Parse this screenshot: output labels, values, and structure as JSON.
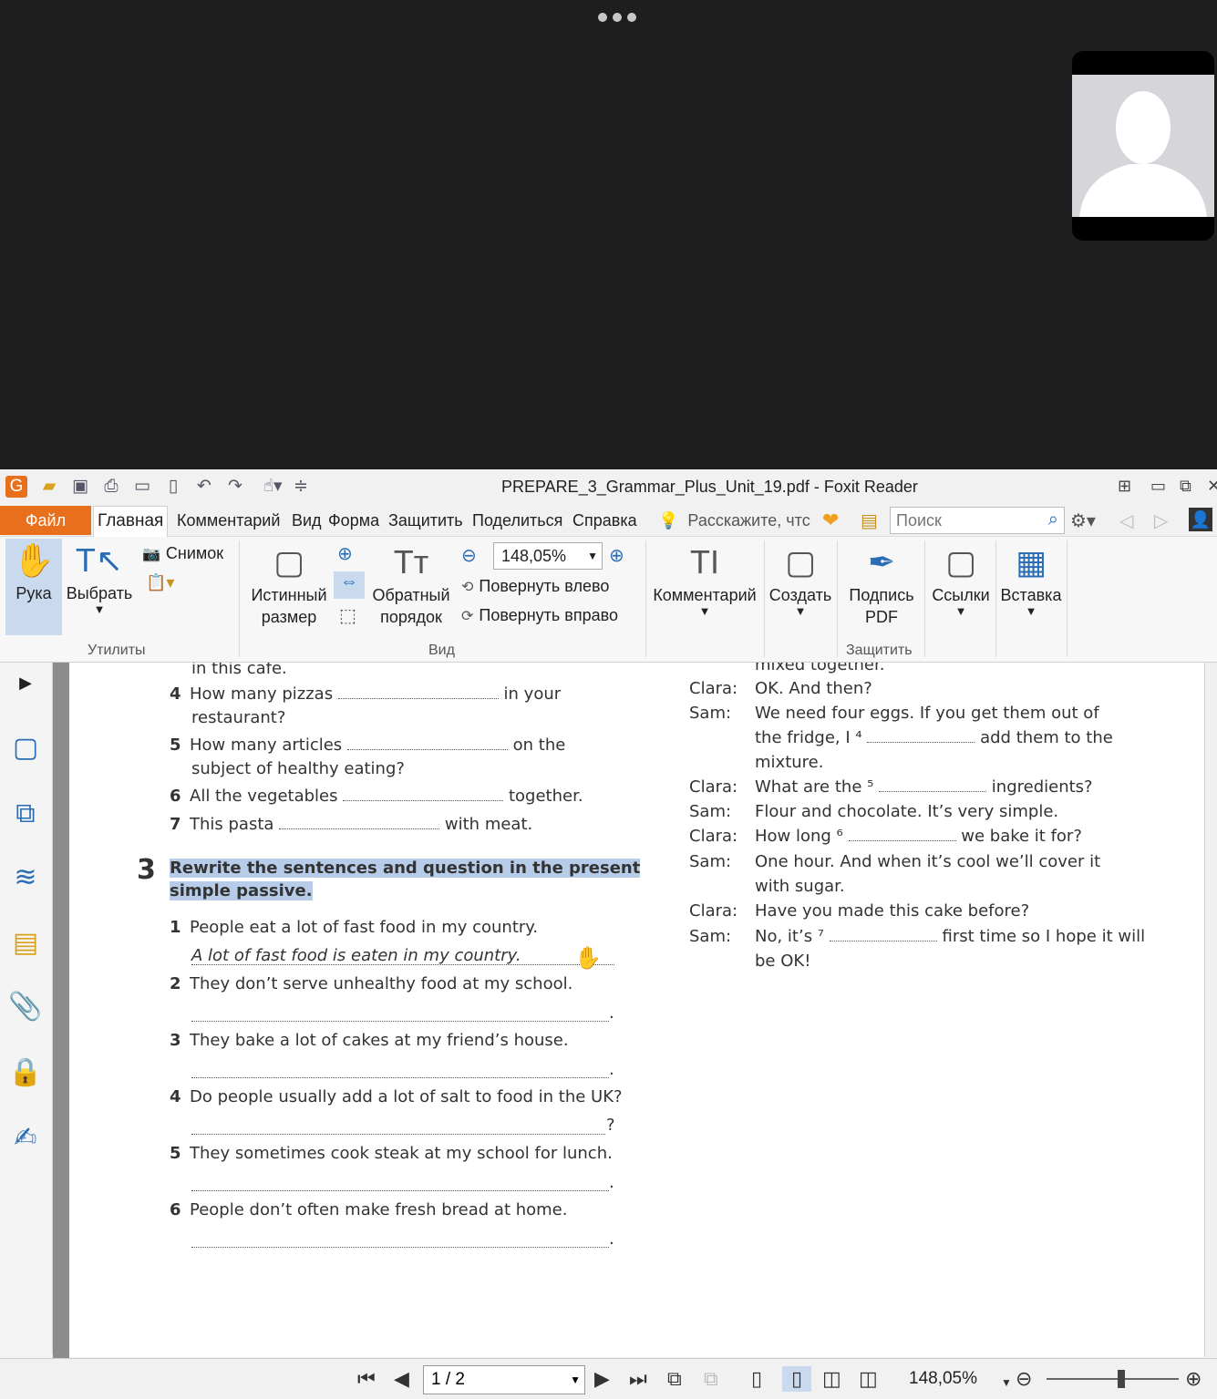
{
  "call": {
    "more_icon": "more-dots-icon",
    "participant_icon": "avatar-silhouette"
  },
  "window": {
    "title": "PREPARE_3_Grammar_Plus_Unit_19.pdf - Foxit Reader"
  },
  "menu": {
    "file": "Файл",
    "tabs": [
      "Главная",
      "Комментарий",
      "Вид",
      "Форма",
      "Защитить",
      "Поделиться",
      "Справка"
    ],
    "tell_me": "Расскажите, чтс",
    "search_placeholder": "Поиск"
  },
  "ribbon": {
    "hand": "Рука",
    "select": "Выбрать",
    "snapshot": "Снимок",
    "group_utils": "Утилиты",
    "actual_size_1": "Истинный",
    "actual_size_2": "размер",
    "reverse_1": "Обратный",
    "reverse_2": "порядок",
    "zoom": "148,05%",
    "rotate_left": "Повернуть влево",
    "rotate_right": "Повернуть вправо",
    "group_view": "Вид",
    "comment": "Комментарий",
    "create": "Создать",
    "sign_1": "Подпись",
    "sign_2": "PDF",
    "group_protect": "Защитить",
    "links": "Ссылки",
    "insert": "Вставка"
  },
  "doc": {
    "left": {
      "top_fragment": "in this cafe.",
      "q4a_num": "4",
      "q4a_pre": "How many pizzas",
      "q4a_post": "in your",
      "q4a_cont": "restaurant?",
      "q5a_num": "5",
      "q5a_pre": "How many articles",
      "q5a_post": "on the",
      "q5a_cont": "subject of healthy eating?",
      "q6a_num": "6",
      "q6a_pre": "All the vegetables",
      "q6a_post": "together.",
      "q7a_num": "7",
      "q7a_pre": "This pasta",
      "q7a_post": "with meat.",
      "sec3_num": "3",
      "sec3_line1": "Rewrite the sentences and question in the present",
      "sec3_line2": "simple passive.",
      "items": [
        {
          "n": "1",
          "text": "People eat a lot of fast food in my country.",
          "answer": "A lot of fast food is eaten in my country.",
          "end": ""
        },
        {
          "n": "2",
          "text": "They don’t serve unhealthy food at my school.",
          "answer": "",
          "end": "."
        },
        {
          "n": "3",
          "text": "They bake a lot of cakes at my friend’s house.",
          "answer": "",
          "end": "."
        },
        {
          "n": "4",
          "text": "Do people usually add a lot of salt to food in the UK?",
          "answer": "",
          "end": "?"
        },
        {
          "n": "5",
          "text": "They sometimes cook steak at my school for lunch.",
          "answer": "",
          "end": "."
        },
        {
          "n": "6",
          "text": "People don’t often make fresh bread at home.",
          "answer": "",
          "end": "."
        }
      ]
    },
    "right": {
      "top_fragment": "mixed together.",
      "lines": [
        {
          "spk": "Clara:",
          "text": "OK. And then?"
        },
        {
          "spk": "Sam:",
          "text": "We need four eggs.  If you get them out of"
        },
        {
          "spk": "",
          "text_pre": "the fridge, I ⁴",
          "text_post": "add them to the"
        },
        {
          "spk": "",
          "text": "mixture."
        },
        {
          "spk": "Clara:",
          "text_pre": "What are the ⁵",
          "text_post": "ingredients?"
        },
        {
          "spk": "Sam:",
          "text": "Flour and chocolate.  It’s very simple."
        },
        {
          "spk": "Clara:",
          "text_pre": "How long ⁶",
          "text_post": "we bake it for?"
        },
        {
          "spk": "Sam:",
          "text": "One hour.  And when it’s cool we’ll cover it"
        },
        {
          "spk": "",
          "text": "with sugar."
        },
        {
          "spk": "Clara:",
          "text": "Have you made this cake before?"
        },
        {
          "spk": "Sam:",
          "text_pre": "No, it’s ⁷",
          "text_post": "first time so I hope it will"
        },
        {
          "spk": "",
          "text": "be OK!"
        }
      ]
    }
  },
  "status": {
    "page": "1 / 2",
    "zoom": "148,05%"
  }
}
